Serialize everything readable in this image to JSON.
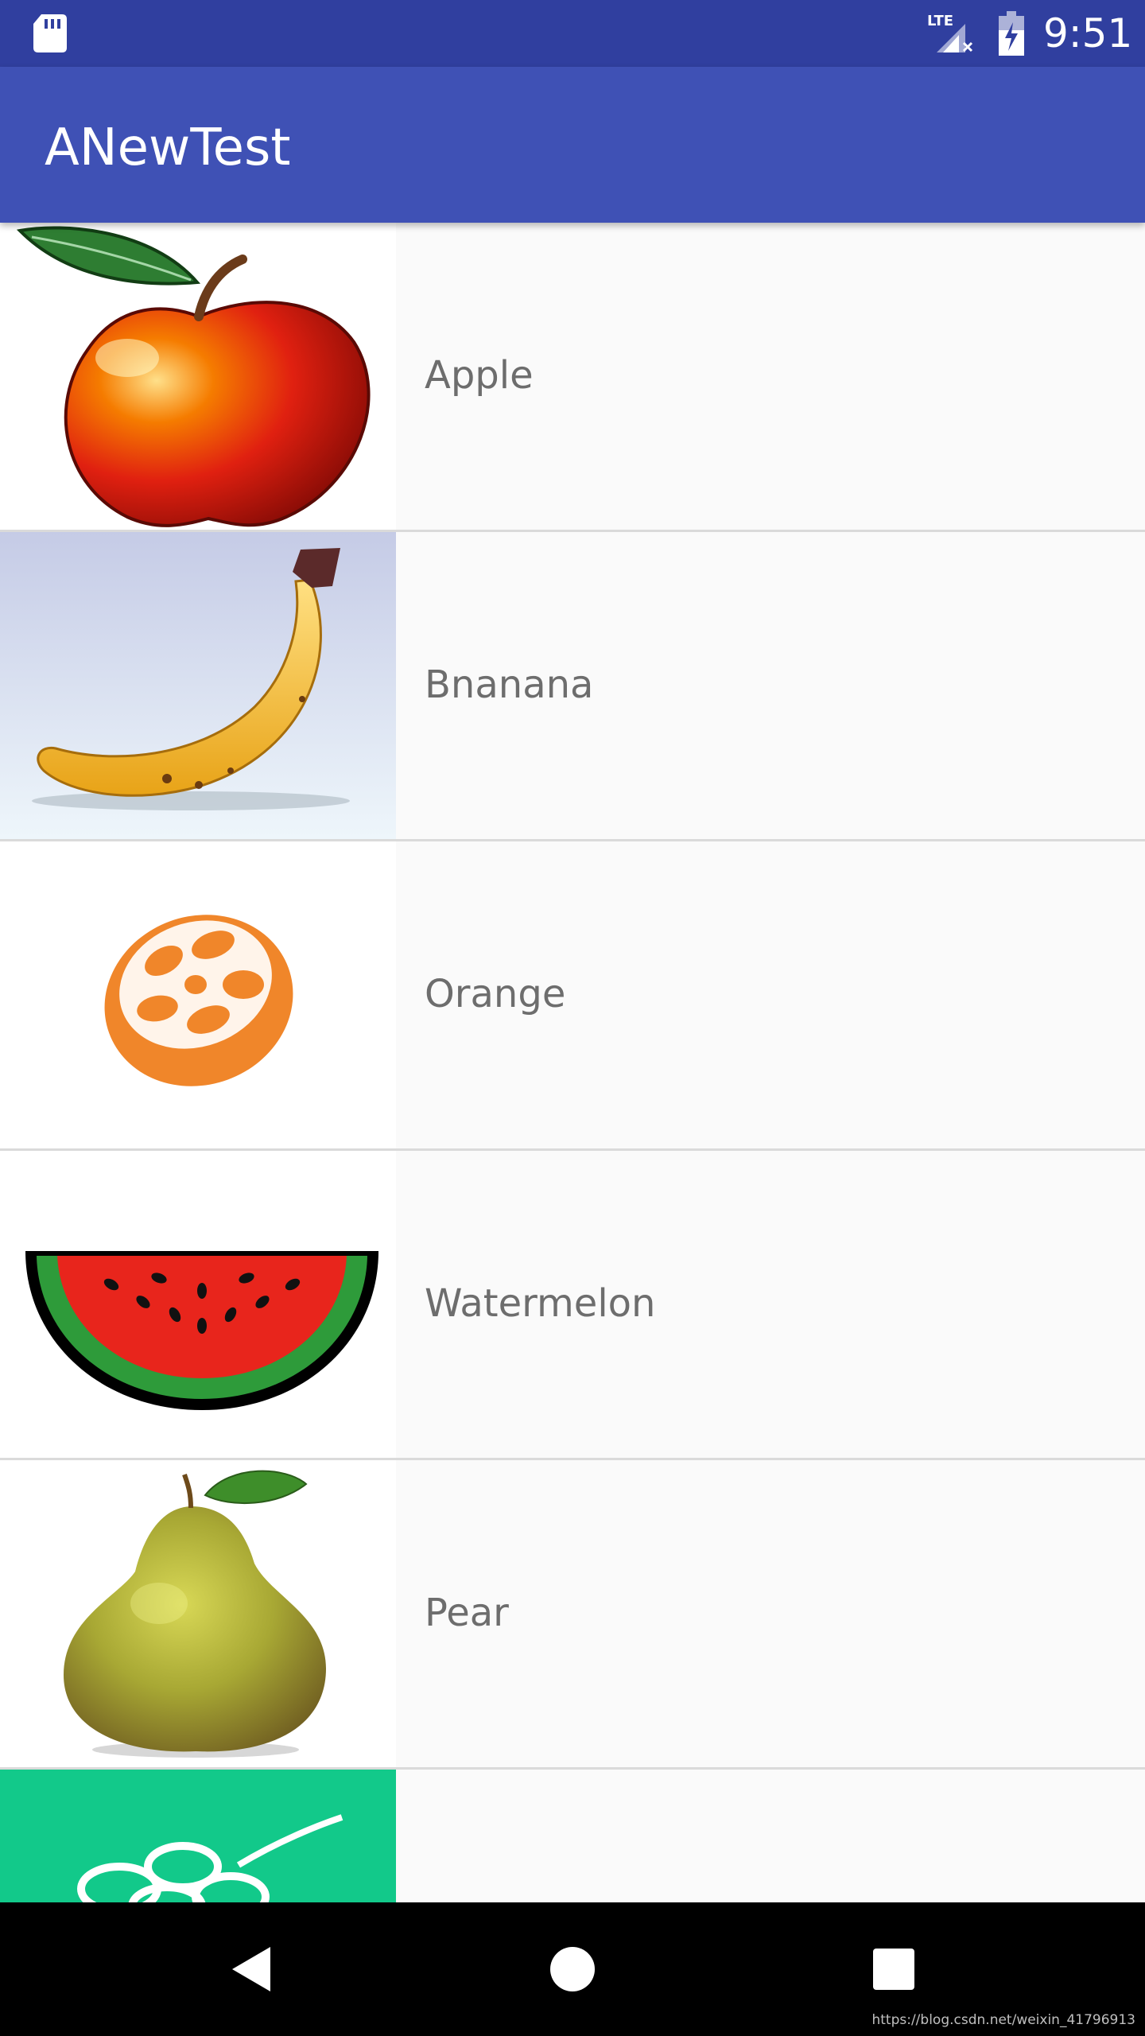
{
  "status_bar": {
    "network": "LTE",
    "time": "9:51",
    "icons": [
      "sd-card-icon",
      "lte-signal-icon",
      "battery-charging-icon"
    ]
  },
  "app_bar": {
    "title": "ANewTest",
    "color": "#3f51b5",
    "status_color": "#303f9f"
  },
  "fruits": [
    {
      "name": "Apple",
      "icon": "apple-image"
    },
    {
      "name": "Bnanana",
      "icon": "banana-image"
    },
    {
      "name": "Orange",
      "icon": "orange-image"
    },
    {
      "name": "Watermelon",
      "icon": "watermelon-image"
    },
    {
      "name": "Pear",
      "icon": "pear-image"
    },
    {
      "name": "",
      "icon": "grape-image"
    }
  ],
  "nav_bar": {
    "buttons": [
      "back-icon",
      "home-icon",
      "recents-icon"
    ]
  },
  "watermark": "https://blog.csdn.net/weixin_41796913"
}
